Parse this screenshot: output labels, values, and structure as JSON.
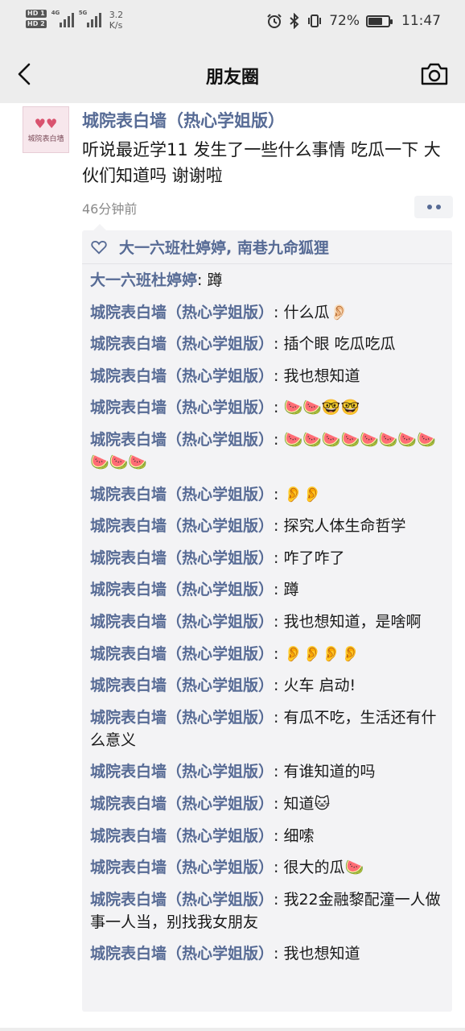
{
  "status_bar": {
    "hd1": "HD 1",
    "hd2": "HD 2",
    "network1": "4G",
    "network2": "5G",
    "speed_value": "3.2",
    "speed_unit": "K/s",
    "battery": "72%",
    "battery_level": 0.72,
    "time": "11:47",
    "icons": [
      "alarm-icon",
      "bluetooth-icon",
      "vibrate-icon"
    ]
  },
  "nav": {
    "title": "朋友圈",
    "back_icon": "back-chevron-icon",
    "camera_icon": "camera-icon"
  },
  "post": {
    "avatar_text": "城院表白墙",
    "author": "城院表白墙（热心学姐版）",
    "text": "听说最近学11 发生了一些什么事情  吃瓜一下  大伙们知道吗  谢谢啦",
    "time": "46分钟前",
    "more_icon": "more-dots-icon"
  },
  "likes": {
    "icon": "heart-outline-icon",
    "names": "大一六班杜婷婷, 南巷九命狐狸"
  },
  "comments": [
    {
      "author": "大一六班杜婷婷",
      "sep": ": ",
      "text": "蹲"
    },
    {
      "author": "城院表白墙（热心学姐版）",
      "sep": ": ",
      "text": "什么瓜👂🏻"
    },
    {
      "author": "城院表白墙（热心学姐版）",
      "sep": ": ",
      "text": "插个眼 吃瓜吃瓜"
    },
    {
      "author": "城院表白墙（热心学姐版）",
      "sep": ": ",
      "text": "我也想知道"
    },
    {
      "author": "城院表白墙（热心学姐版）",
      "sep": ": ",
      "text": "🍉🍉🤓🤓"
    },
    {
      "author": "城院表白墙（热心学姐版）",
      "sep": ": ",
      "text": "🍉🍉🍉🍉🍉🍉🍉🍉🍉🍉🍉"
    },
    {
      "author": "城院表白墙（热心学姐版）",
      "sep": ": ",
      "text": "👂👂"
    },
    {
      "author": "城院表白墙（热心学姐版）",
      "sep": ": ",
      "text": "探究人体生命哲学"
    },
    {
      "author": "城院表白墙（热心学姐版）",
      "sep": ": ",
      "text": "咋了咋了"
    },
    {
      "author": "城院表白墙（热心学姐版）",
      "sep": ": ",
      "text": "蹲"
    },
    {
      "author": "城院表白墙（热心学姐版）",
      "sep": ": ",
      "text": "我也想知道，是啥啊"
    },
    {
      "author": "城院表白墙（热心学姐版）",
      "sep": ": ",
      "text": "👂👂👂👂"
    },
    {
      "author": "城院表白墙（热心学姐版）",
      "sep": ": ",
      "text": "火车 启动!"
    },
    {
      "author": "城院表白墙（热心学姐版）",
      "sep": ": ",
      "text": "有瓜不吃，生活还有什么意义"
    },
    {
      "author": "城院表白墙（热心学姐版）",
      "sep": ": ",
      "text": "有谁知道的吗"
    },
    {
      "author": "城院表白墙（热心学姐版）",
      "sep": ": ",
      "text": "知道🐱"
    },
    {
      "author": "城院表白墙（热心学姐版）",
      "sep": ": ",
      "text": "细嗦"
    },
    {
      "author": "城院表白墙（热心学姐版）",
      "sep": ": ",
      "text": "很大的瓜🍉"
    },
    {
      "author": "城院表白墙（热心学姐版）",
      "sep": ": ",
      "text": "我22金融黎配潼一人做事一人当，别找我女朋友"
    },
    {
      "author": "城院表白墙（热心学姐版）",
      "sep": ": ",
      "text": "我也想知道"
    }
  ],
  "colors": {
    "link": "#576b95",
    "bar_bg": "#ededed",
    "comment_bg": "#f3f3f5"
  }
}
